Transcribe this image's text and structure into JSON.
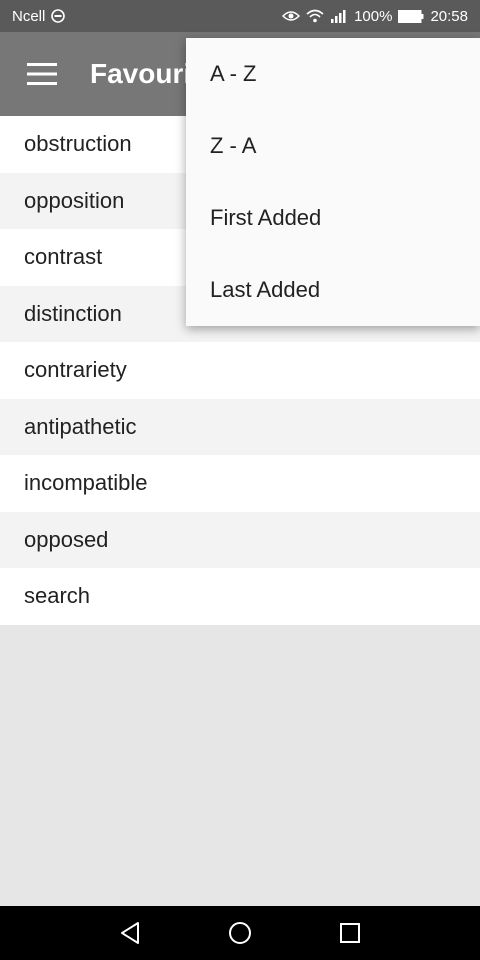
{
  "status_bar": {
    "carrier": "Ncell",
    "battery": "100%",
    "time": "20:58",
    "icons": [
      "carrier-settings-icon",
      "eye-icon",
      "wifi-icon",
      "signal-icon",
      "battery-icon"
    ]
  },
  "app_bar": {
    "title": "Favourites",
    "icons": [
      "hamburger-menu-icon"
    ]
  },
  "list": {
    "items": [
      "obstruction",
      "opposition",
      "contrast",
      "distinction",
      "contrariety",
      "antipathetic",
      "incompatible",
      "opposed",
      "search"
    ]
  },
  "sort_menu": {
    "items": [
      "A - Z",
      "Z - A",
      "First Added",
      "Last Added"
    ]
  },
  "nav_bar": {
    "icons": [
      "back-icon",
      "home-icon",
      "recents-icon"
    ]
  },
  "colors": {
    "status_bar": "#5a5a5a",
    "app_bar": "#777777",
    "list_empty_area": "#e6e6e6",
    "menu": "#fafafa"
  }
}
